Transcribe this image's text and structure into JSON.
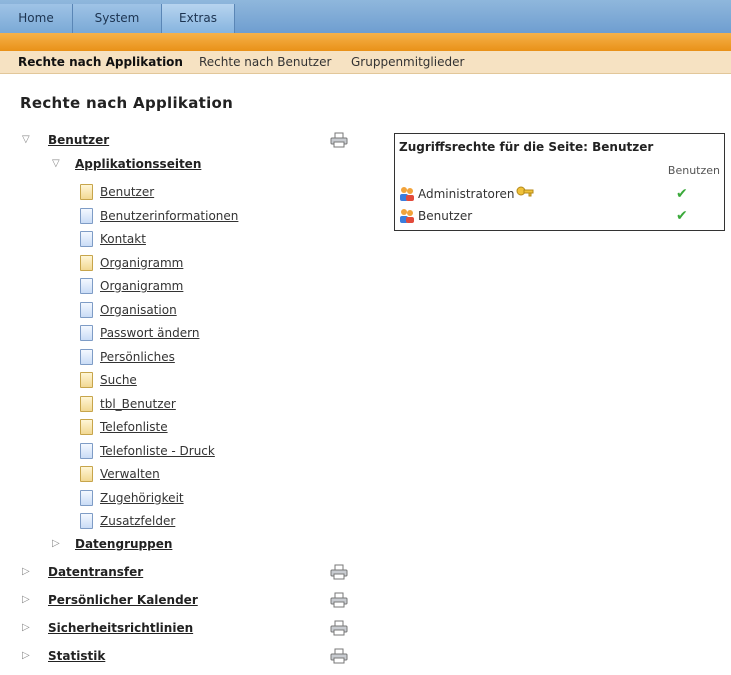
{
  "topnav": {
    "tabs": [
      {
        "label": "Home"
      },
      {
        "label": "System"
      },
      {
        "label": "Extras"
      }
    ]
  },
  "subnav": {
    "items": [
      {
        "label": "Rechte nach Applikation"
      },
      {
        "label": "Rechte nach Benutzer"
      },
      {
        "label": "Gruppenmitglieder"
      }
    ]
  },
  "page": {
    "title": "Rechte nach Applikation"
  },
  "tree": {
    "benutzer": {
      "label": "Benutzer",
      "applikationsseiten": {
        "label": "Applikationsseiten",
        "pages": [
          {
            "label": "Benutzer",
            "icon": "yellow"
          },
          {
            "label": "Benutzerinformationen",
            "icon": "blue"
          },
          {
            "label": "Kontakt",
            "icon": "blue"
          },
          {
            "label": "Organigramm",
            "icon": "yellow"
          },
          {
            "label": "Organigramm",
            "icon": "blue"
          },
          {
            "label": "Organisation",
            "icon": "blue"
          },
          {
            "label": "Passwort ändern",
            "icon": "blue"
          },
          {
            "label": "Persönliches",
            "icon": "blue"
          },
          {
            "label": "Suche",
            "icon": "yellow"
          },
          {
            "label": "tbl_Benutzer",
            "icon": "yellow"
          },
          {
            "label": "Telefonliste",
            "icon": "yellow"
          },
          {
            "label": "Telefonliste - Druck",
            "icon": "blue"
          },
          {
            "label": "Verwalten",
            "icon": "yellow"
          },
          {
            "label": "Zugehörigkeit",
            "icon": "blue"
          },
          {
            "label": "Zusatzfelder",
            "icon": "blue"
          }
        ]
      },
      "datengruppen": {
        "label": "Datengruppen"
      }
    },
    "roots": [
      {
        "label": "Datentransfer"
      },
      {
        "label": "Persönlicher Kalender"
      },
      {
        "label": "Sicherheitsrichtlinien"
      },
      {
        "label": "Statistik"
      }
    ]
  },
  "permissions": {
    "title": "Zugriffsrechte für die Seite: Benutzer",
    "column": "Benutzen",
    "rows": [
      {
        "group": "Administratoren",
        "has_key": true,
        "check": "✔"
      },
      {
        "group": "Benutzer",
        "has_key": false,
        "check": "✔"
      }
    ]
  },
  "colors": {
    "nav_blue": "#7aa9d6",
    "accent_orange": "#e99118",
    "subnav_bg": "#f6e2c2",
    "check_green": "#3aa93a"
  }
}
